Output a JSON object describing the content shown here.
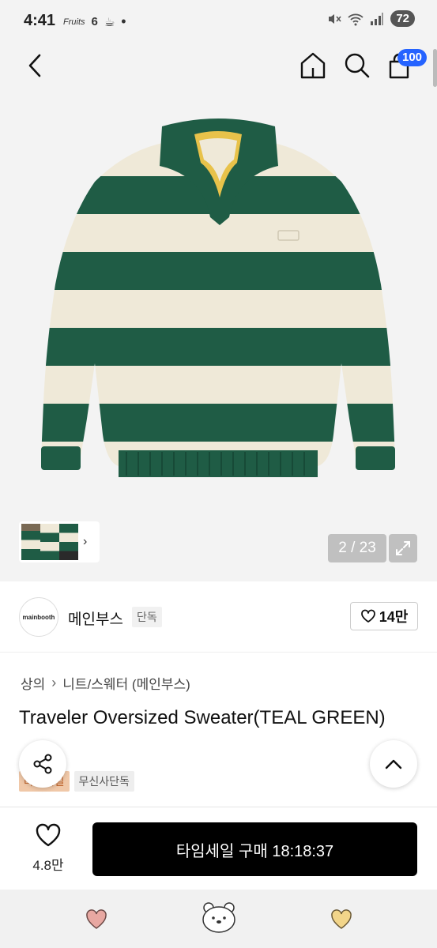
{
  "status_bar": {
    "time": "4:41",
    "left_icons": [
      "Fruits",
      "6",
      "☕",
      "•"
    ],
    "battery": "72"
  },
  "nav": {
    "back_icon": "chevron-left-icon",
    "home_icon": "home-icon",
    "search_icon": "search-icon",
    "cart_icon": "shopping-bag-icon",
    "cart_count": "100"
  },
  "gallery": {
    "page_indicator": "2 / 23",
    "sweater_colors": {
      "green": "#1f5c45",
      "cream": "#efe9d8"
    }
  },
  "brand": {
    "logo_text": "mainbooth",
    "name": "메인부스",
    "tag": "단독",
    "likes": "14만"
  },
  "product": {
    "breadcrumb": [
      "상의",
      "니트/스웨터 (메인부스)"
    ],
    "title": "Traveler Oversized Sweater(TEAL GREEN)",
    "tags": [
      "타임세일",
      "무신사단독"
    ]
  },
  "action_bar": {
    "wish_count": "4.8만",
    "buy_label": "타임세일 구매 18:18:37"
  },
  "colors": {
    "accent_blue": "#2563ff",
    "sale_tag": "#f0c8a8"
  }
}
